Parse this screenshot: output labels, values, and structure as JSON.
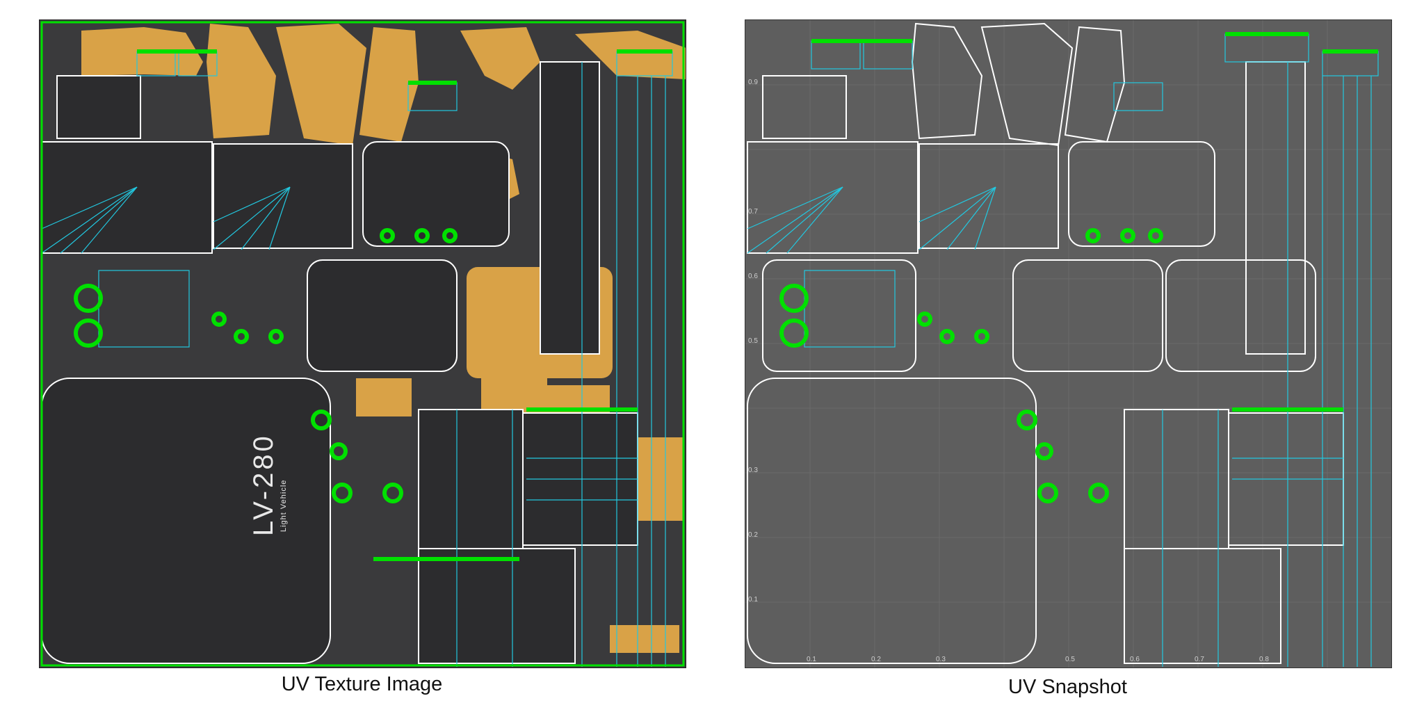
{
  "left": {
    "caption": "UV Texture Image",
    "decal_main": "LV-280",
    "decal_sub": "Light Vehicle"
  },
  "right": {
    "caption": "UV Snapshot",
    "v_ticks": [
      "0.9",
      "0.7",
      "0.6",
      "0.5",
      "0.3",
      "0.2",
      "0.1"
    ],
    "u_ticks": [
      "0.1",
      "0.2",
      "0.3",
      "0.5",
      "0.6",
      "0.7",
      "0.8"
    ]
  },
  "colors": {
    "shell_edge": "#ffffff",
    "seam": "#00e000",
    "wire": "#22c8e0",
    "texture_tan": "#e0a040",
    "texture_dark": "#2e2e30",
    "snapshot_bg": "#5e5e5e"
  }
}
